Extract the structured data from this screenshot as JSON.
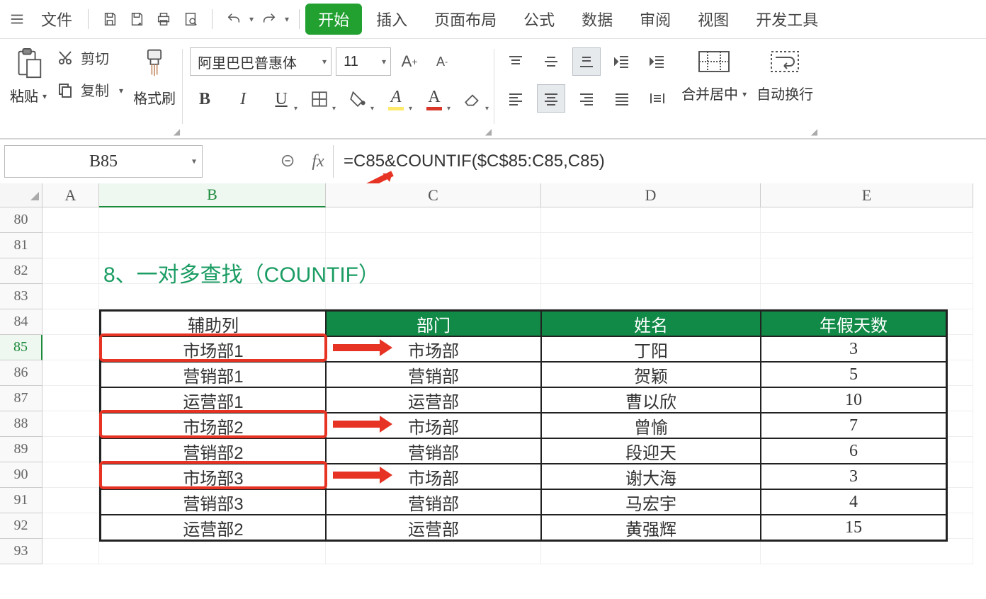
{
  "menu": {
    "file": "文件",
    "items": [
      "开始",
      "插入",
      "页面布局",
      "公式",
      "数据",
      "审阅",
      "视图",
      "开发工具"
    ]
  },
  "ribbon": {
    "paste": "粘贴",
    "cut": "剪切",
    "copy": "复制",
    "format_painter": "格式刷",
    "font_name": "阿里巴巴普惠体",
    "font_size": "11",
    "merge_center": "合并居中",
    "wrap_text": "自动换行"
  },
  "fx": {
    "namebox": "B85",
    "formula": "=C85&COUNTIF($C$85:C85,C85)"
  },
  "sheet": {
    "cols": [
      "A",
      "B",
      "C",
      "D",
      "E"
    ],
    "row_start": 80,
    "row_end": 93,
    "title": "8、一对多查找（COUNTIF）",
    "table": {
      "headers": [
        "辅助列",
        "部门",
        "姓名",
        "年假天数"
      ],
      "rows": [
        {
          "b": "市场部1",
          "c": "市场部",
          "d": "丁阳",
          "e": "3"
        },
        {
          "b": "营销部1",
          "c": "营销部",
          "d": "贺颖",
          "e": "5"
        },
        {
          "b": "运营部1",
          "c": "运营部",
          "d": "曹以欣",
          "e": "10"
        },
        {
          "b": "市场部2",
          "c": "市场部",
          "d": "曾愉",
          "e": "7"
        },
        {
          "b": "营销部2",
          "c": "营销部",
          "d": "段迎天",
          "e": "6"
        },
        {
          "b": "市场部3",
          "c": "市场部",
          "d": "谢大海",
          "e": "3"
        },
        {
          "b": "营销部3",
          "c": "营销部",
          "d": "马宏宇",
          "e": "4"
        },
        {
          "b": "运营部2",
          "c": "运营部",
          "d": "黄强辉",
          "e": "15"
        }
      ]
    }
  }
}
